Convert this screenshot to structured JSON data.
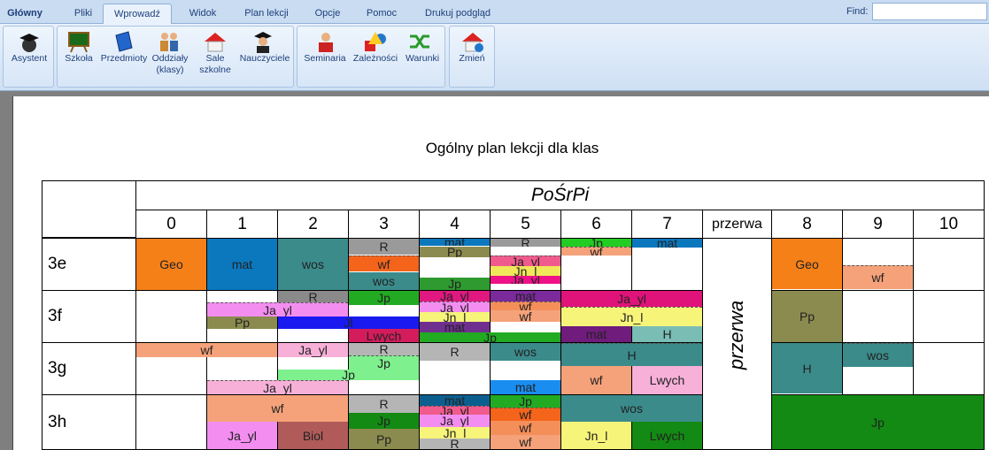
{
  "tabs": [
    {
      "label": "Główny"
    },
    {
      "label": "Pliki"
    },
    {
      "label": "Wprowadź"
    },
    {
      "label": "Widok"
    },
    {
      "label": "Plan lekcji"
    },
    {
      "label": "Opcje"
    },
    {
      "label": "Pomoc"
    },
    {
      "label": "Drukuj podgląd"
    }
  ],
  "find": {
    "label": "Find:",
    "value": ""
  },
  "ribbon": {
    "buttons": [
      {
        "label": "Asystent",
        "icon": "graduate-globe-icon"
      },
      {
        "label": "Szkoła",
        "icon": "chalkboard-icon"
      },
      {
        "label": "Przedmioty",
        "icon": "book-icon"
      },
      {
        "label": "Oddziały\n(klasy)",
        "icon": "people-group-icon"
      },
      {
        "label": "Sale\nszkolne",
        "icon": "house-icon"
      },
      {
        "label": "Nauczyciele",
        "icon": "teacher-icon"
      },
      {
        "label": "Seminaria",
        "icon": "presenter-icon"
      },
      {
        "label": "Zależności",
        "icon": "shapes-icon"
      },
      {
        "label": "Warunki",
        "icon": "shuffle-icon"
      },
      {
        "label": "Zmień",
        "icon": "house-change-icon"
      }
    ]
  },
  "page": {
    "title": "Ogólny plan lekcji dla klas",
    "days": "PoŚrPi",
    "periods": [
      "0",
      "1",
      "2",
      "3",
      "4",
      "5",
      "6",
      "7",
      "przerwa",
      "8",
      "9",
      "10"
    ],
    "break_label": "przerwa"
  },
  "classes": [
    "3e",
    "3f",
    "3g",
    "3h"
  ],
  "lessons": [
    {
      "t": "Geo",
      "c": "#f68018"
    },
    {
      "t": "mat",
      "c": "#0b78be"
    },
    {
      "t": "wos",
      "c": "#3b8b8b"
    },
    {
      "t": "R",
      "c": "#9a9a9a"
    },
    {
      "t": "wf",
      "c": "#f5641b"
    },
    {
      "t": "wos",
      "c": "#3b8b8b"
    },
    {
      "t": "mat",
      "c": "#0b78be"
    },
    {
      "t": "Pp",
      "c": "#8b8b4f"
    },
    {
      "t": "Jp",
      "c": "#2f9a2f"
    },
    {
      "t": "R",
      "c": "#9a9a9a"
    },
    {
      "t": "Ja_yl",
      "c": "#f05a8c"
    },
    {
      "t": "Jn_l",
      "c": "#f0e85a"
    },
    {
      "t": "Ja_yl",
      "c": "#ee1188"
    },
    {
      "t": "Jp",
      "c": "#22cc22"
    },
    {
      "t": "wf",
      "c": "#f5a27a"
    },
    {
      "t": "mat",
      "c": "#0b78be"
    },
    {
      "t": "Geo",
      "c": "#f68018"
    },
    {
      "t": "wf",
      "c": "#f5a27a"
    },
    {
      "t": "R",
      "c": "#8a8a8a"
    },
    {
      "t": "Ja_yl",
      "c": "#f38ef0"
    },
    {
      "t": "Pp",
      "c": "#8b8b4f"
    },
    {
      "t": "Jl",
      "c": "#1a1af0"
    },
    {
      "t": "Jp",
      "c": "#22aa22"
    },
    {
      "t": "Lwych",
      "c": "#d41c5c"
    },
    {
      "t": "Ja_yl",
      "c": "#e01880"
    },
    {
      "t": "Ja_yl",
      "c": "#f38ef0"
    },
    {
      "t": "Jn_l",
      "c": "#f7f47a"
    },
    {
      "t": "mat",
      "c": "#6f2f8f"
    },
    {
      "t": "Jp",
      "c": "#22aa22"
    },
    {
      "t": "mat",
      "c": "#7a2a9a"
    },
    {
      "t": "wf",
      "c": "#f58f5a"
    },
    {
      "t": "wf",
      "c": "#f5a27a"
    },
    {
      "t": "Ja_yl",
      "c": "#e0137a"
    },
    {
      "t": "Jn_l",
      "c": "#f7f47a"
    },
    {
      "t": "mat",
      "c": "#701c7c"
    },
    {
      "t": "H",
      "c": "#79bdb5"
    },
    {
      "t": "Pp",
      "c": "#8b8b4f"
    },
    {
      "t": "wf",
      "c": "#f5a27a"
    },
    {
      "t": "Ja_yl",
      "c": "#f7b0d8"
    },
    {
      "t": "Ja_yl",
      "c": "#f7b0d8"
    },
    {
      "t": "R",
      "c": "#b5b5b5"
    },
    {
      "t": "Jp",
      "c": "#7ef08e"
    },
    {
      "t": "Jp",
      "c": "#7ef08e"
    },
    {
      "t": "R",
      "c": "#b5b5b5"
    },
    {
      "t": "wos",
      "c": "#3b8b8b"
    },
    {
      "t": "mat",
      "c": "#1a8ef0"
    },
    {
      "t": "H",
      "c": "#3b8b8b"
    },
    {
      "t": "wf",
      "c": "#f5a27a"
    },
    {
      "t": "Lwych",
      "c": "#f7b0d8"
    },
    {
      "t": "H",
      "c": "#3b8b8b"
    },
    {
      "t": "wos",
      "c": "#3b8b8b"
    },
    {
      "t": "wf",
      "c": "#f5a27a"
    },
    {
      "t": "Ja_yl",
      "c": "#f38ef0"
    },
    {
      "t": "Biol",
      "c": "#b05a5a"
    },
    {
      "t": "R",
      "c": "#b5b5b5"
    },
    {
      "t": "Jp",
      "c": "#138a13"
    },
    {
      "t": "Pp",
      "c": "#8b8b4f"
    },
    {
      "t": "mat",
      "c": "#0b5f8f"
    },
    {
      "t": "Ja_yl",
      "c": "#f05a8c"
    },
    {
      "t": "Ja_yl",
      "c": "#f38ef0"
    },
    {
      "t": "Jn_l",
      "c": "#f7f47a"
    },
    {
      "t": "R",
      "c": "#b5b5b5"
    },
    {
      "t": "Jp",
      "c": "#22aa22"
    },
    {
      "t": "wf",
      "c": "#f5641b"
    },
    {
      "t": "wf",
      "c": "#f58f5a"
    },
    {
      "t": "wf",
      "c": "#f5a27a"
    },
    {
      "t": "wos",
      "c": "#3b8b8b"
    },
    {
      "t": "Jn_l",
      "c": "#f7f47a"
    },
    {
      "t": "Lwych",
      "c": "#138a13"
    },
    {
      "t": "Jp",
      "c": "#138a13"
    },
    {
      "t": "mat",
      "c": "#0b5f8f"
    }
  ]
}
